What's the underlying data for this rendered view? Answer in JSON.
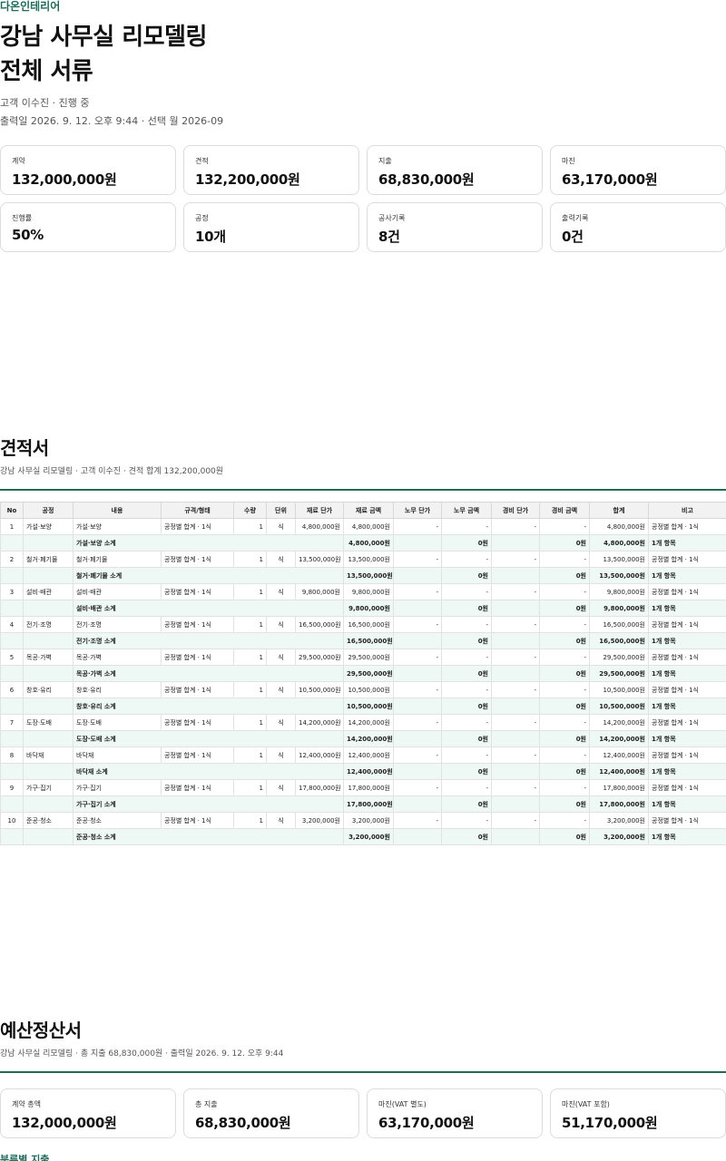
{
  "brand": "다온인테리어",
  "title_line1": "강남 사무실 리모델링",
  "title_line2": "전체 서류",
  "meta_client": "고객 이수진 · 진행 중",
  "meta_print": "출력일 2026. 9. 12. 오후 9:44 · 선택 월 2026-09",
  "summary_cards": [
    {
      "label": "계약",
      "value": "132,000,000원"
    },
    {
      "label": "견적",
      "value": "132,200,000원"
    },
    {
      "label": "지출",
      "value": "68,830,000원"
    },
    {
      "label": "마진",
      "value": "63,170,000원"
    },
    {
      "label": "진행률",
      "value": "50%"
    },
    {
      "label": "공정",
      "value": "10개"
    },
    {
      "label": "공사기록",
      "value": "8건"
    },
    {
      "label": "출력기록",
      "value": "0건"
    }
  ],
  "estimate": {
    "title": "견적서",
    "subtitle": "강남 사무실 리모델링 · 고객 이수진 · 견적 합계 132,200,000원",
    "columns": [
      "No",
      "공정",
      "내용",
      "규격/형태",
      "수량",
      "단위",
      "재료 단가",
      "재료 금액",
      "노무 단가",
      "노무 금액",
      "경비 단가",
      "경비 금액",
      "합계",
      "비고"
    ],
    "rows": [
      {
        "type": "item",
        "cells": [
          "1",
          "가설·보양",
          "가설·보양",
          "공정별 합계 · 1식",
          "1",
          "식",
          "4,800,000원",
          "4,800,000원",
          "-",
          "-",
          "-",
          "-",
          "4,800,000원",
          "공정별 합계 · 1식"
        ]
      },
      {
        "type": "sub",
        "cells": [
          "",
          "",
          "가설·보양 소계",
          "",
          "",
          "",
          "",
          "4,800,000원",
          "",
          "0원",
          "",
          "0원",
          "4,800,000원",
          "1개 항목"
        ]
      },
      {
        "type": "item",
        "cells": [
          "2",
          "철거·폐기물",
          "철거·폐기물",
          "공정별 합계 · 1식",
          "1",
          "식",
          "13,500,000원",
          "13,500,000원",
          "-",
          "-",
          "-",
          "-",
          "13,500,000원",
          "공정별 합계 · 1식"
        ]
      },
      {
        "type": "sub",
        "cells": [
          "",
          "",
          "철거·폐기물 소계",
          "",
          "",
          "",
          "",
          "13,500,000원",
          "",
          "0원",
          "",
          "0원",
          "13,500,000원",
          "1개 항목"
        ]
      },
      {
        "type": "item",
        "cells": [
          "3",
          "설비·배관",
          "설비·배관",
          "공정별 합계 · 1식",
          "1",
          "식",
          "9,800,000원",
          "9,800,000원",
          "-",
          "-",
          "-",
          "-",
          "9,800,000원",
          "공정별 합계 · 1식"
        ]
      },
      {
        "type": "sub",
        "cells": [
          "",
          "",
          "설비·배관 소계",
          "",
          "",
          "",
          "",
          "9,800,000원",
          "",
          "0원",
          "",
          "0원",
          "9,800,000원",
          "1개 항목"
        ]
      },
      {
        "type": "item",
        "cells": [
          "4",
          "전기·조명",
          "전기·조명",
          "공정별 합계 · 1식",
          "1",
          "식",
          "16,500,000원",
          "16,500,000원",
          "-",
          "-",
          "-",
          "-",
          "16,500,000원",
          "공정별 합계 · 1식"
        ]
      },
      {
        "type": "sub",
        "cells": [
          "",
          "",
          "전기·조명 소계",
          "",
          "",
          "",
          "",
          "16,500,000원",
          "",
          "0원",
          "",
          "0원",
          "16,500,000원",
          "1개 항목"
        ]
      },
      {
        "type": "item",
        "cells": [
          "5",
          "목공·가벽",
          "목공·가벽",
          "공정별 합계 · 1식",
          "1",
          "식",
          "29,500,000원",
          "29,500,000원",
          "-",
          "-",
          "-",
          "-",
          "29,500,000원",
          "공정별 합계 · 1식"
        ]
      },
      {
        "type": "sub",
        "cells": [
          "",
          "",
          "목공·가벽 소계",
          "",
          "",
          "",
          "",
          "29,500,000원",
          "",
          "0원",
          "",
          "0원",
          "29,500,000원",
          "1개 항목"
        ]
      },
      {
        "type": "item",
        "cells": [
          "6",
          "창호·유리",
          "창호·유리",
          "공정별 합계 · 1식",
          "1",
          "식",
          "10,500,000원",
          "10,500,000원",
          "-",
          "-",
          "-",
          "-",
          "10,500,000원",
          "공정별 합계 · 1식"
        ]
      },
      {
        "type": "sub",
        "cells": [
          "",
          "",
          "창호·유리 소계",
          "",
          "",
          "",
          "",
          "10,500,000원",
          "",
          "0원",
          "",
          "0원",
          "10,500,000원",
          "1개 항목"
        ]
      },
      {
        "type": "item",
        "cells": [
          "7",
          "도장·도배",
          "도장·도배",
          "공정별 합계 · 1식",
          "1",
          "식",
          "14,200,000원",
          "14,200,000원",
          "-",
          "-",
          "-",
          "-",
          "14,200,000원",
          "공정별 합계 · 1식"
        ]
      },
      {
        "type": "sub",
        "cells": [
          "",
          "",
          "도장·도배 소계",
          "",
          "",
          "",
          "",
          "14,200,000원",
          "",
          "0원",
          "",
          "0원",
          "14,200,000원",
          "1개 항목"
        ]
      },
      {
        "type": "item",
        "cells": [
          "8",
          "바닥재",
          "바닥재",
          "공정별 합계 · 1식",
          "1",
          "식",
          "12,400,000원",
          "12,400,000원",
          "-",
          "-",
          "-",
          "-",
          "12,400,000원",
          "공정별 합계 · 1식"
        ]
      },
      {
        "type": "sub",
        "cells": [
          "",
          "",
          "바닥재 소계",
          "",
          "",
          "",
          "",
          "12,400,000원",
          "",
          "0원",
          "",
          "0원",
          "12,400,000원",
          "1개 항목"
        ]
      },
      {
        "type": "item",
        "cells": [
          "9",
          "가구·집기",
          "가구·집기",
          "공정별 합계 · 1식",
          "1",
          "식",
          "17,800,000원",
          "17,800,000원",
          "-",
          "-",
          "-",
          "-",
          "17,800,000원",
          "공정별 합계 · 1식"
        ]
      },
      {
        "type": "sub",
        "cells": [
          "",
          "",
          "가구·집기 소계",
          "",
          "",
          "",
          "",
          "17,800,000원",
          "",
          "0원",
          "",
          "0원",
          "17,800,000원",
          "1개 항목"
        ]
      },
      {
        "type": "item",
        "cells": [
          "10",
          "준공·청소",
          "준공·청소",
          "공정별 합계 · 1식",
          "1",
          "식",
          "3,200,000원",
          "3,200,000원",
          "-",
          "-",
          "-",
          "-",
          "3,200,000원",
          "공정별 합계 · 1식"
        ]
      },
      {
        "type": "sub",
        "cells": [
          "",
          "",
          "준공·청소 소계",
          "",
          "",
          "",
          "",
          "3,200,000원",
          "",
          "0원",
          "",
          "0원",
          "3,200,000원",
          "1개 항목"
        ]
      }
    ]
  },
  "budget": {
    "title": "예산정산서",
    "subtitle": "강남 사무실 리모델링 · 총 지출 68,830,000원 · 출력일 2026. 9. 12. 오후 9:44",
    "cards": [
      {
        "label": "계약 총액",
        "value": "132,000,000원"
      },
      {
        "label": "총 지출",
        "value": "68,830,000원"
      },
      {
        "label": "마진(VAT 별도)",
        "value": "63,170,000원"
      },
      {
        "label": "마진(VAT 포함)",
        "value": "51,170,000원"
      }
    ],
    "next_heading": "분류별 지출"
  }
}
